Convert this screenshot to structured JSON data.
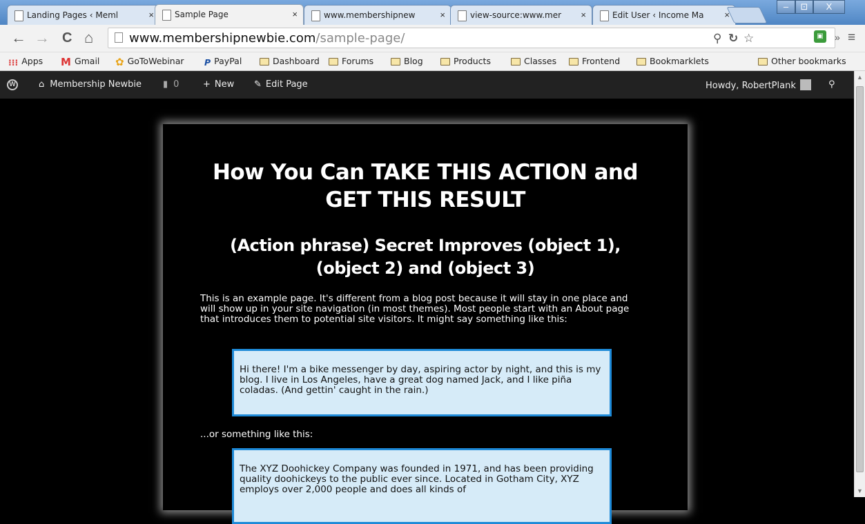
{
  "browser": {
    "tabs": [
      {
        "label": "Landing Pages ‹ Meml",
        "active": false
      },
      {
        "label": "Sample Page",
        "active": true
      },
      {
        "label": "www.membershipnew",
        "active": false
      },
      {
        "label": "view-source:www.mer",
        "active": false
      },
      {
        "label": "Edit User ‹ Income Ma",
        "active": false
      }
    ],
    "tab_close": "×",
    "window": {
      "min": "‒",
      "max": "⊡",
      "close": "X"
    },
    "nav": {
      "back": "←",
      "forward": "→",
      "reload": "C",
      "home": "⌂"
    },
    "url": {
      "host": "www.membershipnewbie.com",
      "path": "/sample-page/"
    },
    "omni_icons": {
      "zoom": "zoom-icon",
      "ext": "refresh-ext-icon",
      "star": "☆"
    },
    "ext_label": "▣",
    "overflow": "»",
    "menu": "≡"
  },
  "bookmarks": {
    "items": [
      {
        "label": "Apps",
        "icon": "apps-icon"
      },
      {
        "label": "Gmail",
        "icon": "gmail-icon"
      },
      {
        "label": "GoToWebinar",
        "icon": "gotowebinar-icon"
      },
      {
        "label": "PayPal",
        "icon": "paypal-icon"
      },
      {
        "label": "Dashboard",
        "icon": "folder-icon"
      },
      {
        "label": "Forums",
        "icon": "folder-icon"
      },
      {
        "label": "Blog",
        "icon": "folder-icon"
      },
      {
        "label": "Products",
        "icon": "folder-icon"
      },
      {
        "label": "Classes",
        "icon": "folder-icon"
      },
      {
        "label": "Frontend",
        "icon": "folder-icon"
      },
      {
        "label": "Bookmarklets",
        "icon": "folder-icon"
      }
    ],
    "other": "Other bookmarks"
  },
  "adminbar": {
    "site": "Membership Newbie",
    "comments": "0",
    "new": "New",
    "edit": "Edit Page",
    "howdy": "Howdy, RobertPlank"
  },
  "page": {
    "h1_line1": "How You Can TAKE THIS ACTION and",
    "h1_line2": "GET THIS RESULT",
    "h2_line1": "(Action phrase) Secret Improves (object 1),",
    "h2_line2": "(object 2) and (object 3)",
    "intro": "This is an example page. It's different from a blog post because it will stay in one place and will show up in your site navigation (in most themes). Most people start with an About page that introduces them to potential site visitors. It might say something like this:",
    "quote1": "Hi there! I'm a bike messenger by day, aspiring actor by night, and this is my blog. I live in Los Angeles, have a great dog named Jack, and I like piña coladas. (And gettin' caught in the rain.)",
    "or_text": "...or something like this:",
    "quote2": "The XYZ Doohickey Company was founded in 1971, and has been providing quality doohickeys to the public ever since. Located in Gotham City, XYZ employs over 2,000 people and does all kinds of"
  }
}
